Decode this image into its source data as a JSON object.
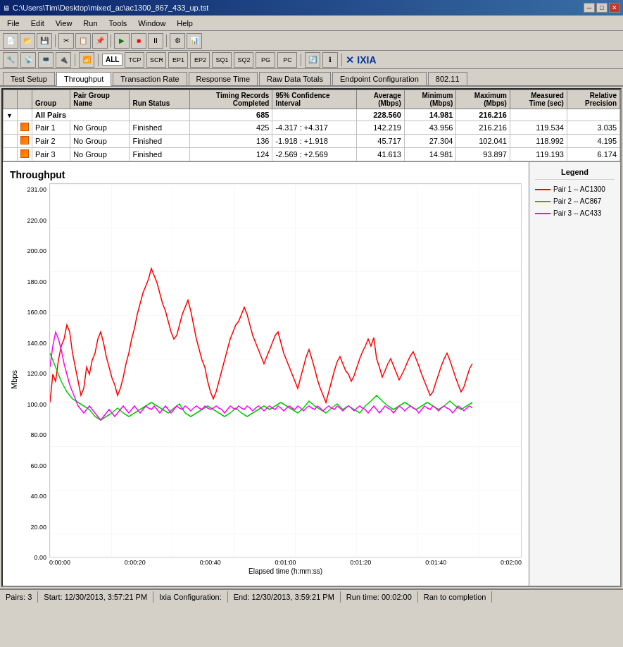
{
  "titleBar": {
    "text": "C:\\Users\\Tim\\Desktop\\mixed_ac\\ac1300_867_433_up.tst",
    "minBtn": "─",
    "maxBtn": "□",
    "closeBtn": "✕"
  },
  "menuBar": {
    "items": [
      "File",
      "Edit",
      "View",
      "Run",
      "Tools",
      "Window",
      "Help"
    ]
  },
  "toolbar2": {
    "tcpLabel": "TCP",
    "scr": "SCR",
    "ep1": "EP1",
    "ep2": "EP2",
    "sq1": "SQ1",
    "sq2": "SQ2",
    "pg": "PG",
    "pc": "PC",
    "all": "ALL",
    "ixia": "IXIA"
  },
  "tabs": {
    "items": [
      "Test Setup",
      "Throughput",
      "Transaction Rate",
      "Response Time",
      "Raw Data Totals",
      "Endpoint Configuration",
      "802.11"
    ],
    "active": 1
  },
  "tableHeaders": {
    "group": "Group",
    "pairGroupName": "Pair Group Name",
    "runStatus": "Run Status",
    "timingRecordsCompleted": "Timing Records Completed",
    "confidence95": "95% Confidence Interval",
    "average": "Average (Mbps)",
    "minimum": "Minimum (Mbps)",
    "maximum": "Maximum (Mbps)",
    "measuredTime": "Measured Time (sec)",
    "relativePrecision": "Relative Precision"
  },
  "tableData": {
    "allPairs": {
      "name": "All Pairs",
      "records": "685",
      "confidence": "",
      "average": "228.560",
      "minimum": "14.981",
      "maximum": "216.216",
      "measuredTime": "",
      "relativePrecision": ""
    },
    "rows": [
      {
        "icon": "orange",
        "pair": "Pair 1",
        "group": "No Group",
        "status": "Finished",
        "records": "425",
        "confidence": "-4.317 : +4.317",
        "average": "142.219",
        "minimum": "43.956",
        "maximum": "216.216",
        "measuredTime": "119.534",
        "relativePrecision": "3.035"
      },
      {
        "icon": "orange",
        "pair": "Pair 2",
        "group": "No Group",
        "status": "Finished",
        "records": "136",
        "confidence": "-1.918 : +1.918",
        "average": "45.717",
        "minimum": "27.304",
        "maximum": "102.041",
        "measuredTime": "118.992",
        "relativePrecision": "4.195"
      },
      {
        "icon": "orange",
        "pair": "Pair 3",
        "group": "No Group",
        "status": "Finished",
        "records": "124",
        "confidence": "-2.569 : +2.569",
        "average": "41.613",
        "minimum": "14.981",
        "maximum": "93.897",
        "measuredTime": "119.193",
        "relativePrecision": "6.174"
      }
    ]
  },
  "chart": {
    "title": "Throughput",
    "yLabel": "Mbps",
    "xLabel": "Elapsed time (h:mm:ss)",
    "yAxis": [
      "231.00",
      "220.00",
      "200.00",
      "180.00",
      "160.00",
      "140.00",
      "120.00",
      "100.00",
      "80.00",
      "60.00",
      "40.00",
      "20.00",
      "0.00"
    ],
    "xAxis": [
      "0:00:00",
      "0:00:20",
      "0:00:40",
      "0:01:00",
      "0:01:20",
      "0:01:40",
      "0:02:00"
    ]
  },
  "legend": {
    "title": "Legend",
    "items": [
      {
        "label": "Pair 1 -- AC1300",
        "color": "#ff0000"
      },
      {
        "label": "Pair 2 -- AC867",
        "color": "#00cc00"
      },
      {
        "label": "Pair 3 -- AC433",
        "color": "#ff00ff"
      }
    ]
  },
  "statusBar": {
    "pairs": "Pairs: 3",
    "start": "Start: 12/30/2013, 3:57:21 PM",
    "ixia": "Ixia Configuration:",
    "end": "End: 12/30/2013, 3:59:21 PM",
    "runTime": "Run time: 00:02:00",
    "completion": "Ran to completion"
  }
}
